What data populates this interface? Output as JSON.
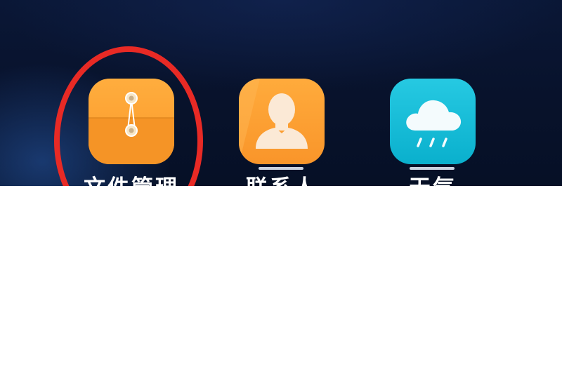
{
  "apps": [
    {
      "label": "文件管理",
      "icon": "file-folder-icon",
      "color": "#fb9a2a"
    },
    {
      "label": "联系人",
      "icon": "person-icon",
      "color": "#f9952a"
    },
    {
      "label": "天气",
      "icon": "rain-cloud-icon",
      "color": "#0ab0cd"
    }
  ],
  "highlight_color": "#e82a25",
  "background_color": "#08122b"
}
